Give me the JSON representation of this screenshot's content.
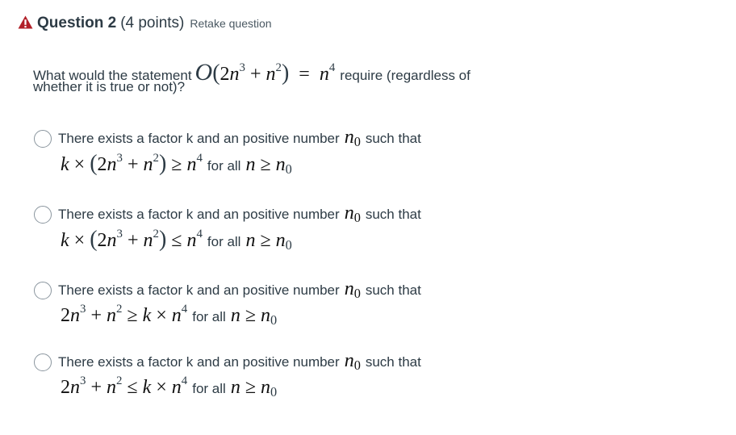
{
  "header": {
    "icon": "warning-icon",
    "icon_color": "#b11f28",
    "title": "Question 2",
    "points": "(4 points)",
    "retake_label": "Retake question"
  },
  "prompt": {
    "text_before": "What would the statement",
    "math": "O(2n³ + n²) = n⁴",
    "text_after": "require (regardless of",
    "text_line2": "whether it is true or not)?"
  },
  "options": [
    {
      "text": "There exists a factor k and an positive number",
      "n0": "n₀",
      "text_tail": "such that",
      "expression": "k × (2n³ + n²) ≥ n⁴",
      "condition_label": "for all",
      "condition_math": "n ≥ n₀"
    },
    {
      "text": "There exists a factor k and an positive number",
      "n0": "n₀",
      "text_tail": "such that",
      "expression": "k × (2n³ + n²) ≤ n⁴",
      "condition_label": "for all",
      "condition_math": "n ≥ n₀"
    },
    {
      "text": "There exists a factor k and an positive number",
      "n0": "n₀",
      "text_tail": "such that",
      "expression": "2n³ + n² ≥ k × n⁴",
      "condition_label": "for all",
      "condition_math": "n ≥ n₀"
    },
    {
      "text": "There exists a factor k and an positive number",
      "n0": "n₀",
      "text_tail": "such that",
      "expression": "2n³ + n² ≤ k × n⁴",
      "condition_label": "for all",
      "condition_math": "n ≥ n₀"
    }
  ]
}
